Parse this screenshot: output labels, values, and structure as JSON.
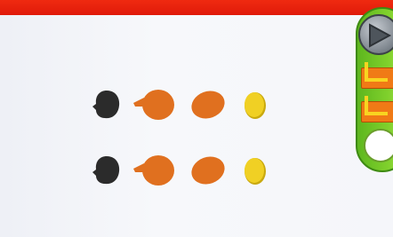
{
  "colors": {
    "top_bar": "#e8200c",
    "background": "#f3f4f8",
    "dark_piece": "#2b2b2b",
    "orange_piece": "#e0701f",
    "yellow_piece": "#f0d024",
    "panel_green": "#6cc224",
    "slot_orange": "#f07a16"
  },
  "rows": [
    {
      "pieces": [
        "dark-blob",
        "orange-drop",
        "orange-oval",
        "yellow-oval"
      ]
    },
    {
      "pieces": [
        "dark-blob",
        "orange-drop",
        "orange-oval",
        "yellow-oval"
      ]
    }
  ],
  "side_panel": {
    "buttons": [
      "play-icon",
      "slot-1",
      "slot-2",
      "white-circle"
    ]
  }
}
